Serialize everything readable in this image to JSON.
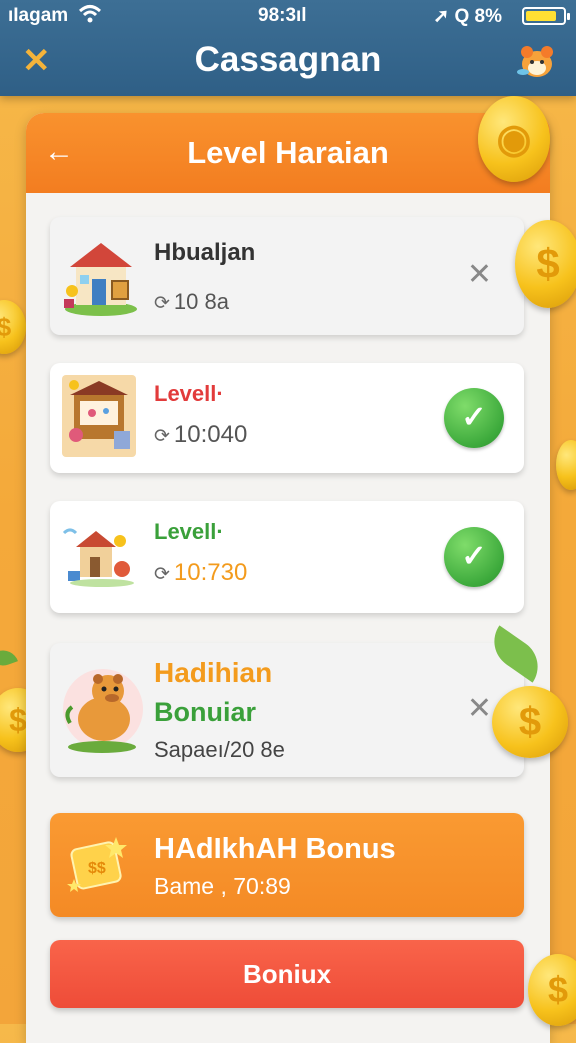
{
  "status_bar": {
    "carrier": "ıIagam",
    "time": "98:3ıl",
    "right_text": "Q 8%",
    "icons": [
      "wifi-icon",
      "location-arrow-icon",
      "battery-icon"
    ]
  },
  "app_bar": {
    "title": "Cassagnan",
    "close_icon": "close-icon",
    "avatar_icon": "mascot-icon"
  },
  "panel": {
    "title": "Level Haraian",
    "back_icon": "back-arrow-icon"
  },
  "items": [
    {
      "title": "Hbualjan",
      "time": "10 8a",
      "title_color": "#333333",
      "action": "x"
    },
    {
      "title": "Levell·",
      "time": "10:040",
      "title_color": "#e23b3b",
      "action": "check"
    },
    {
      "title": "Levell·",
      "time": "10:730",
      "title_color": "#3aa03a",
      "time_highlight_color": "#f39b1d",
      "action": "check"
    }
  ],
  "reward_item": {
    "title_1": "Hadihian",
    "title_2": "Bonuiar",
    "subtitle": "Sapaeı/20 8e",
    "title_1_color": "#f39b1d",
    "title_2_color": "#3aa03a"
  },
  "bonus_card": {
    "title": "HAdIkhAH Bonus",
    "subtitle": "Bame , 70:89"
  },
  "bonus_button": {
    "label": "Boniux"
  },
  "colors": {
    "app_bar": "#2f5f86",
    "panel_header": "#f37d20",
    "bonus_card": "#f48a25",
    "bonus_button": "#ee4c38",
    "background": "#f4a93a"
  }
}
